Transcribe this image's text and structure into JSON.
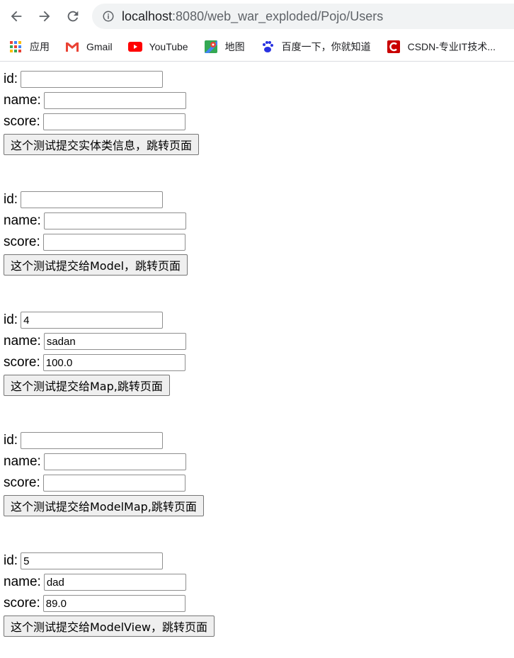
{
  "browser": {
    "url_host": "localhost",
    "url_rest": ":8080/web_war_exploded/Pojo/Users",
    "bookmarks": [
      {
        "label": "应用",
        "icon": "apps-grid-icon"
      },
      {
        "label": "Gmail",
        "icon": "gmail-icon"
      },
      {
        "label": "YouTube",
        "icon": "youtube-icon"
      },
      {
        "label": "地图",
        "icon": "maps-icon"
      },
      {
        "label": "百度一下，你就知道",
        "icon": "baidu-icon"
      },
      {
        "label": "CSDN-专业IT技术...",
        "icon": "csdn-icon"
      }
    ]
  },
  "labels": {
    "id": "id:",
    "name": "name:",
    "score": "score:"
  },
  "forms": [
    {
      "id": "",
      "name": "",
      "score": "",
      "button": "这个测试提交实体类信息，跳转页面"
    },
    {
      "id": "",
      "name": "",
      "score": "",
      "button": "这个测试提交给Model，跳转页面"
    },
    {
      "id": "4",
      "name": "sadan",
      "score": "100.0",
      "button": "这个测试提交给Map,跳转页面"
    },
    {
      "id": "",
      "name": "",
      "score": "",
      "button": "这个测试提交给ModelMap,跳转页面"
    },
    {
      "id": "5",
      "name": "dad",
      "score": "89.0",
      "button": "这个测试提交给ModelView，跳转页面"
    }
  ],
  "colors": {
    "youtube": "#ff0000",
    "csdn": "#c90000",
    "baidu": "#2932e1"
  }
}
